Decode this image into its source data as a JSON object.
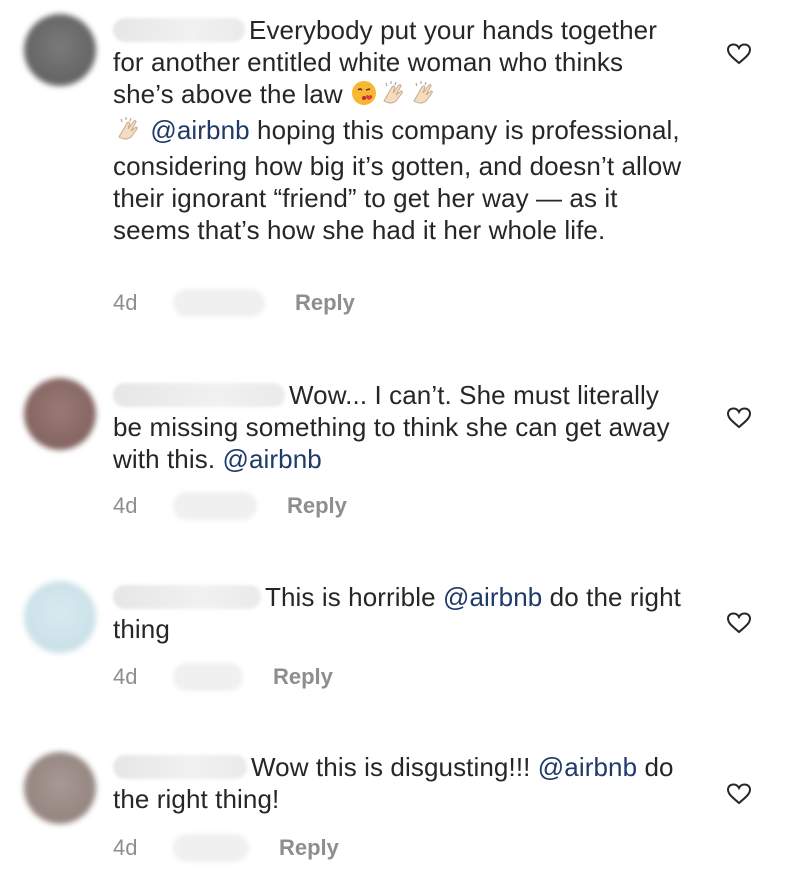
{
  "comments": [
    {
      "text_before_mention": "Everybody put your hands together for another entitled white woman who thinks she’s above the law ",
      "mention": "@airbnb",
      "text_after_mention": " hoping this company is professional, considering how big it’s gotten, and doesn’t allow their ignorant “friend” to get her way — as it seems that’s how she had it her whole life.",
      "time": "4d",
      "reply_label": "Reply",
      "avatar_color": "#6b6b6b"
    },
    {
      "text_before_mention": "Wow... I can’t. She must literally be missing something to think she can get away with this. ",
      "mention": "@airbnb",
      "text_after_mention": "",
      "time": "4d",
      "reply_label": "Reply",
      "avatar_color": "#8a6a67"
    },
    {
      "text_before_mention": "This is horrible ",
      "mention": "@airbnb",
      "text_after_mention": " do the right thing",
      "time": "4d",
      "reply_label": "Reply",
      "avatar_color": "#cfe3ea"
    },
    {
      "text_before_mention": "Wow this is disgusting!!! ",
      "mention": "@airbnb",
      "text_after_mention": " do the right thing!",
      "time": "4d",
      "reply_label": "Reply",
      "avatar_color": "#9b8c86"
    }
  ],
  "colors": {
    "text": "#262626",
    "mention": "#1f3a69",
    "meta": "#8e8e8e"
  },
  "icons": {
    "like": "heart-outline-icon",
    "emoji_kiss": "face-blowing-kiss-emoji",
    "emoji_clap": "clapping-hands-emoji"
  }
}
